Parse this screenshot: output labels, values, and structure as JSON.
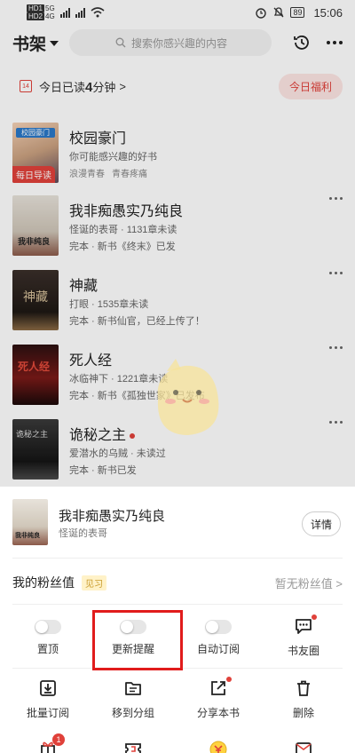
{
  "status_bar": {
    "sim1": "HD1",
    "sim2": "HD2",
    "net1": "5G",
    "net2": "4G",
    "battery": "89",
    "time": "15:06"
  },
  "header": {
    "title": "书架",
    "search_placeholder": "搜索你感兴趣的内容"
  },
  "reading": {
    "prefix": "今日已读",
    "minutes": "4",
    "suffix": "分钟",
    "arrow": ">",
    "welfare": "今日福利",
    "calendar_label": "14"
  },
  "books": [
    {
      "title": "校园豪门",
      "subtitle": "你可能感兴趣的好书",
      "tags": [
        "浪漫青春",
        "青春疼痛"
      ],
      "badge": "每日导读",
      "cover_text": "校园豪门"
    },
    {
      "title": "我非痴愚实乃纯良",
      "subtitle": "怪诞的表哥 · 1131章未读",
      "meta": "完本 · 新书《终末》已发",
      "cover_text": "我非纯良"
    },
    {
      "title": "神藏",
      "subtitle": "打眼 · 1535章未读",
      "meta": "完本 · 新书仙官，已经上传了！",
      "cover_text": "神藏"
    },
    {
      "title": "死人经",
      "subtitle": "冰临神下 · 1221章未读",
      "meta": "完本 · 新书《孤独世家》已发布",
      "cover_text": "死人经"
    },
    {
      "title": "诡秘之主",
      "subtitle": "爱潜水的乌贼 · 未读过",
      "meta": "完本 · 新书已发",
      "cover_text": "诡秘之主"
    }
  ],
  "sheet": {
    "book_title": "我非痴愚实乃纯良",
    "book_author": "怪诞的表哥",
    "detail_label": "详情",
    "fan_label": "我的粉丝值",
    "fan_level": "见习",
    "fan_value": "暂无粉丝值",
    "fan_arrow": ">",
    "row1": [
      {
        "label": "置顶",
        "type": "toggle"
      },
      {
        "label": "更新提醒",
        "type": "toggle"
      },
      {
        "label": "自动订阅",
        "type": "toggle"
      },
      {
        "label": "书友圈",
        "type": "icon",
        "icon": "chat-icon"
      }
    ],
    "row2": [
      {
        "label": "批量订阅",
        "icon": "download-icon"
      },
      {
        "label": "移到分组",
        "icon": "folder-icon"
      },
      {
        "label": "分享本书",
        "icon": "share-icon"
      },
      {
        "label": "删除",
        "icon": "trash-icon"
      }
    ],
    "row3_badge": "1"
  },
  "colors": {
    "accent": "#e0413a",
    "highlight": "#e11c1c"
  }
}
